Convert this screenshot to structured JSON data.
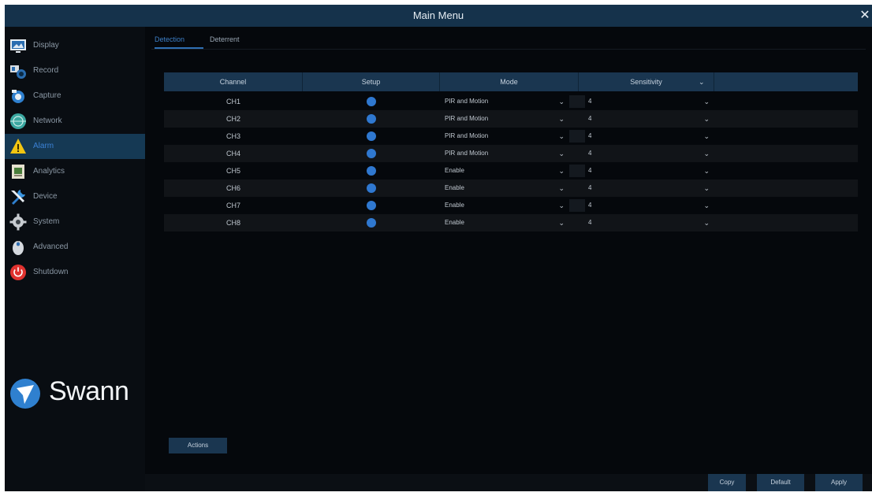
{
  "window": {
    "title": "Main Menu"
  },
  "sidebar": {
    "items": [
      {
        "label": "Display",
        "icon": "display-icon",
        "active": false
      },
      {
        "label": "Record",
        "icon": "camera-icon",
        "active": false
      },
      {
        "label": "Capture",
        "icon": "capture-icon",
        "active": false
      },
      {
        "label": "Network",
        "icon": "globe-icon",
        "active": false
      },
      {
        "label": "Alarm",
        "icon": "alarm-warning-icon",
        "active": true
      },
      {
        "label": "Analytics",
        "icon": "analytics-icon",
        "active": false
      },
      {
        "label": "Device",
        "icon": "tools-icon",
        "active": false
      },
      {
        "label": "System",
        "icon": "gear-icon",
        "active": false
      },
      {
        "label": "Advanced",
        "icon": "mouse-icon",
        "active": false
      },
      {
        "label": "Shutdown",
        "icon": "power-icon",
        "active": false
      }
    ]
  },
  "logo": {
    "text": "Swann",
    "icon": "swann-logo-icon"
  },
  "tabs": [
    {
      "label": "Detection",
      "active": true
    },
    {
      "label": "Deterrent",
      "active": false
    }
  ],
  "table": {
    "headers": {
      "channel": "Channel",
      "setup": "Setup",
      "mode": "Mode",
      "sensitivity": "Sensitivity"
    },
    "rows": [
      {
        "channel": "CH1",
        "mode": "PIR and Motion",
        "sensitivity": "4"
      },
      {
        "channel": "CH2",
        "mode": "PIR and Motion",
        "sensitivity": "4"
      },
      {
        "channel": "CH3",
        "mode": "PIR and Motion",
        "sensitivity": "4"
      },
      {
        "channel": "CH4",
        "mode": "PIR and Motion",
        "sensitivity": "4"
      },
      {
        "channel": "CH5",
        "mode": "Enable",
        "sensitivity": "4"
      },
      {
        "channel": "CH6",
        "mode": "Enable",
        "sensitivity": "4"
      },
      {
        "channel": "CH7",
        "mode": "Enable",
        "sensitivity": "4"
      },
      {
        "channel": "CH8",
        "mode": "Enable",
        "sensitivity": "4"
      }
    ]
  },
  "buttons": {
    "actions": "Actions",
    "copy": "Copy",
    "default": "Default",
    "apply": "Apply"
  },
  "colors": {
    "accent": "#2f78d0",
    "header": "#15324b",
    "active_nav": "#153954"
  }
}
